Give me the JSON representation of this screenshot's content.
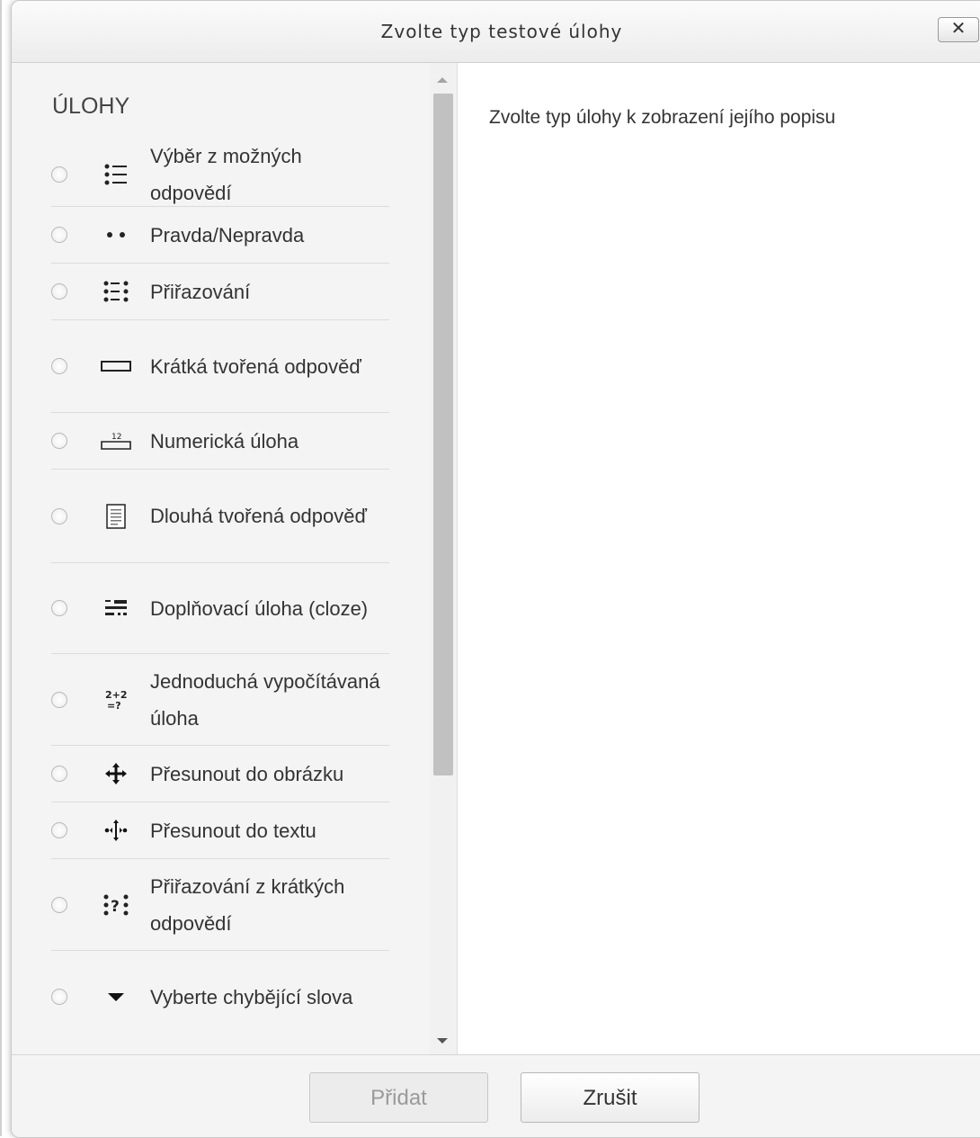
{
  "dialog": {
    "title": "Zvolte typ testové úlohy",
    "close_label": "✕"
  },
  "left": {
    "heading": "ÚLOHY",
    "options": [
      {
        "label": "Výběr z možných odpovědí",
        "icon": "multichoice-icon"
      },
      {
        "label": "Pravda/Nepravda",
        "icon": "truefalse-icon"
      },
      {
        "label": "Přiřazování",
        "icon": "matching-icon"
      },
      {
        "label": "Krátká tvořená odpověď",
        "icon": "shortanswer-icon"
      },
      {
        "label": "Numerická úloha",
        "icon": "numerical-icon"
      },
      {
        "label": "Dlouhá tvořená odpověď",
        "icon": "essay-icon"
      },
      {
        "label": "Doplňovací úloha (cloze)",
        "icon": "cloze-icon"
      },
      {
        "label": "Jednoduchá vypočítávaná úloha",
        "icon": "calculated-simple-icon"
      },
      {
        "label": "Přesunout do obrázku",
        "icon": "drag-drop-image-icon"
      },
      {
        "label": "Přesunout do textu",
        "icon": "drag-drop-text-icon"
      },
      {
        "label": "Přiřazování z krátkých odpovědí",
        "icon": "random-shortanswer-matching-icon"
      },
      {
        "label": "Vyberte chybějící slova",
        "icon": "select-missing-words-icon"
      }
    ]
  },
  "right": {
    "description": "Zvolte typ úlohy k zobrazení jejího popisu"
  },
  "footer": {
    "add_label": "Přidat",
    "cancel_label": "Zrušit"
  },
  "colors": {
    "header_bg": "#eeeeee",
    "panel_bg": "#f4f4f4",
    "text": "#333333",
    "disabled_text": "#9a9a9a"
  }
}
